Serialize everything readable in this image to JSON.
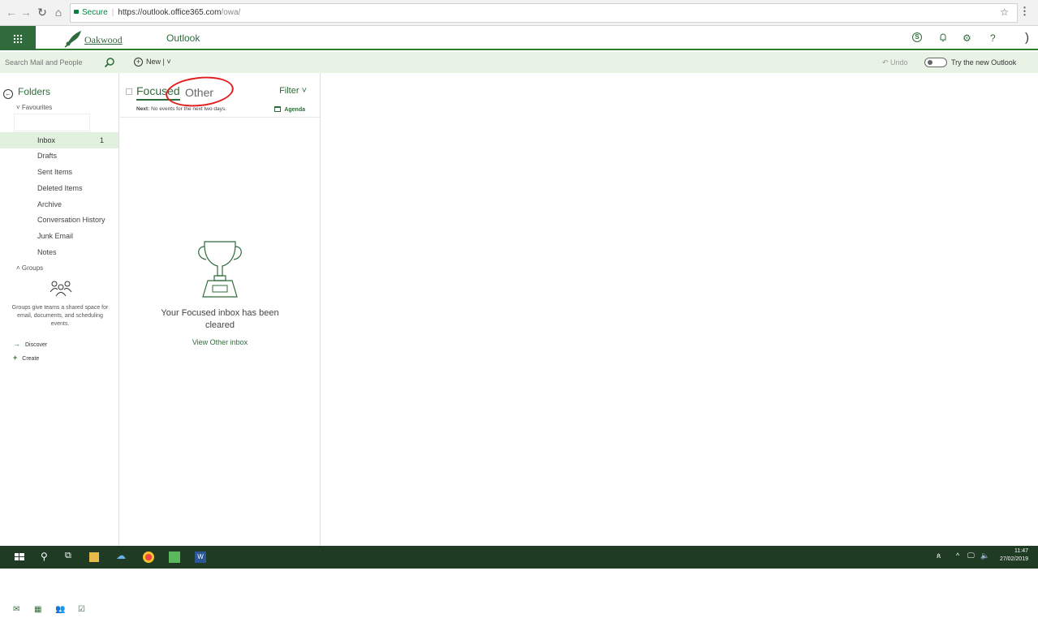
{
  "browser": {
    "secure_label": "Secure",
    "url_host": "https://outlook.office365.com",
    "url_path": "/owa/"
  },
  "header": {
    "logo_text": "Oakwood",
    "app_title": "Outlook"
  },
  "command_bar": {
    "search_placeholder": "Search Mail and People",
    "new_label": "New",
    "undo_label": "Undo",
    "try_new_label": "Try the new Outlook"
  },
  "nav": {
    "folders_label": "Folders",
    "favourites_label": "Favourites",
    "items": [
      {
        "label": "Inbox",
        "count": "1"
      },
      {
        "label": "Drafts"
      },
      {
        "label": "Sent Items"
      },
      {
        "label": "Deleted Items"
      },
      {
        "label": "Archive"
      },
      {
        "label": "Conversation History"
      },
      {
        "label": "Junk Email"
      },
      {
        "label": "Notes"
      }
    ],
    "groups_label": "Groups",
    "groups_desc": "Groups give teams a shared space for email, documents, and scheduling events.",
    "discover_label": "Discover",
    "create_label": "Create"
  },
  "message_list": {
    "tab_focused": "Focused",
    "tab_other": "Other",
    "filter_label": "Filter",
    "next_prefix": "Next:",
    "next_text": "No events for the next two days.",
    "agenda_label": "Agenda",
    "empty_text": "Your Focused inbox has been cleared",
    "view_other_link": "View Other inbox"
  },
  "taskbar": {
    "time": "11:47",
    "date": "27/02/2019"
  },
  "colors": {
    "brand_green": "#2f6b3b",
    "annotation_red": "#e02020"
  }
}
